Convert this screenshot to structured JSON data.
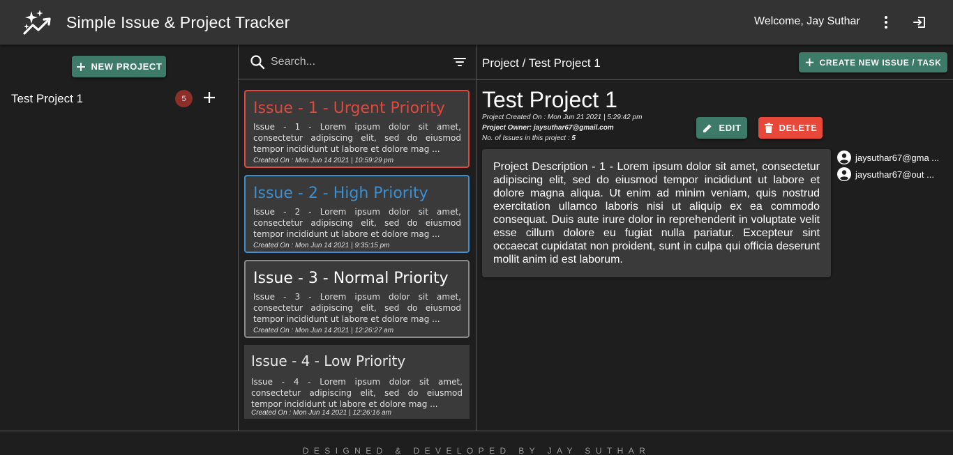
{
  "app": {
    "title": "Simple Issue & Project Tracker",
    "welcome": "Welcome, Jay Suthar",
    "logo_icon": "sparkle-trend-icon",
    "menu_icon": "more-vert-icon",
    "logout_icon": "logout-icon"
  },
  "sidebar": {
    "new_project_label": "NEW PROJECT",
    "projects": [
      {
        "name": "Test Project 1",
        "issue_count": "5"
      }
    ]
  },
  "issues_panel": {
    "search_placeholder": "Search...",
    "issues": [
      {
        "title": "Issue - 1 - Urgent Priority",
        "priority": "urgent",
        "description": "Issue - 1 - Lorem ipsum dolor sit amet, consectetur adipiscing elit, sed do eiusmod tempor incididunt ut labore et dolore mag ...",
        "created": "Created On : Mon Jun 14 2021 | 10:59:29 pm"
      },
      {
        "title": "Issue - 2 - High Priority",
        "priority": "high",
        "description": "Issue - 2 - Lorem ipsum dolor sit amet, consectetur adipiscing elit, sed do eiusmod tempor incididunt ut labore et dolore mag ...",
        "created": "Created On : Mon Jun 14 2021 | 9:35:15 pm"
      },
      {
        "title": "Issue - 3 - Normal Priority",
        "priority": "normal",
        "description": "Issue - 3 - Lorem ipsum dolor sit amet, consectetur adipiscing elit, sed do eiusmod tempor incididunt ut labore et dolore mag ...",
        "created": "Created On : Mon Jun 14 2021 | 12:26:27 am"
      },
      {
        "title": "Issue - 4 - Low Priority",
        "priority": "low",
        "description": "Issue - 4 - Lorem ipsum dolor sit amet, consectetur adipiscing elit, sed do eiusmod tempor incididunt ut labore et dolore mag ...",
        "created": "Created On : Mon Jun 14 2021 | 12:26:16 am"
      }
    ]
  },
  "detail": {
    "breadcrumb": "Project / Test Project 1",
    "create_issue_label": "CREATE NEW ISSUE / TASK",
    "title": "Test Project 1",
    "created": "Project Created On : Mon Jun 21 2021 | 5:29:42 pm",
    "owner": "Project Owner: jaysuthar67@gmail.com",
    "issue_count_label": "No. of Issues in this project : ",
    "issue_count": "5",
    "edit_label": "EDIT",
    "delete_label": "DELETE",
    "description": "Project Description - 1 - Lorem ipsum dolor sit amet, consectetur adipiscing elit, sed do eiusmod tempor incididunt ut labore et dolore magna aliqua. Ut enim ad minim veniam, quis nostrud exercitation ullamco laboris nisi ut aliquip ex ea commodo consequat. Duis aute irure dolor in reprehenderit in voluptate velit esse cillum dolore eu fugiat nulla pariatur. Excepteur sint occaecat cupidatat non proident, sunt in culpa qui officia deserunt mollit anim id est laborum.",
    "members": [
      "jaysuthar67@gma ...",
      "jaysuthar67@out ..."
    ]
  },
  "footer": {
    "text": "DESIGNED & DEVELOPED BY JAY SUTHAR"
  },
  "colors": {
    "urgent": "#e0483d",
    "high": "#3a8fd1",
    "normal": "#8a8a8a",
    "accent_teal": "#3d7a68",
    "danger": "#e8483a",
    "badge": "#8b2f28"
  }
}
